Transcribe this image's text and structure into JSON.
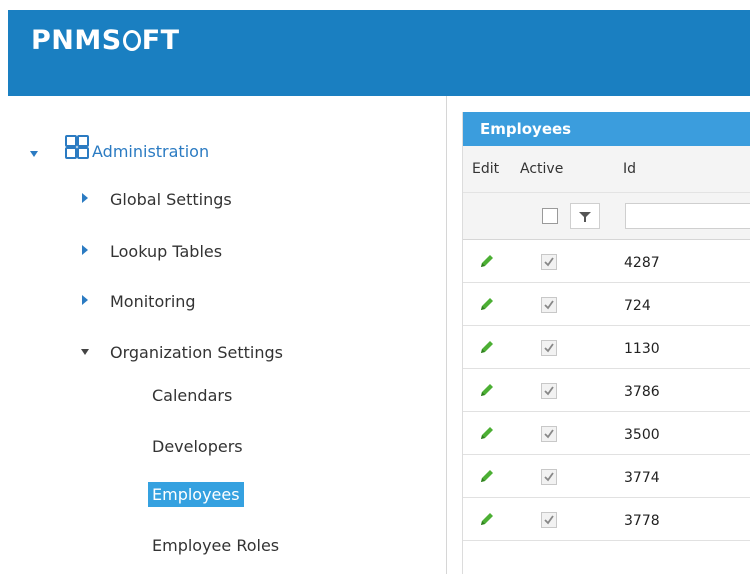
{
  "header": {
    "logo_text": "PNMSOFT",
    "brand_color": "#1a7fc1"
  },
  "sidebar": {
    "root": {
      "label": "Administration",
      "icon": "grid-apps-icon"
    },
    "items": [
      {
        "label": "Global Settings",
        "state": "collapsed"
      },
      {
        "label": "Lookup Tables",
        "state": "collapsed"
      },
      {
        "label": "Monitoring",
        "state": "collapsed"
      },
      {
        "label": "Organization Settings",
        "state": "expanded"
      }
    ],
    "sub_items": [
      {
        "label": "Calendars",
        "selected": false
      },
      {
        "label": "Developers",
        "selected": false
      },
      {
        "label": "Employees",
        "selected": true
      },
      {
        "label": "Employee Roles",
        "selected": false
      }
    ]
  },
  "grid": {
    "title": "Employees",
    "columns": {
      "edit": "Edit",
      "active": "Active",
      "id": "Id"
    },
    "filter": {
      "id_value": ""
    },
    "rows": [
      {
        "id": "4287",
        "active": true
      },
      {
        "id": "724",
        "active": true
      },
      {
        "id": "1130",
        "active": true
      },
      {
        "id": "3786",
        "active": true
      },
      {
        "id": "3500",
        "active": true
      },
      {
        "id": "3774",
        "active": true
      },
      {
        "id": "3778",
        "active": true
      }
    ]
  }
}
